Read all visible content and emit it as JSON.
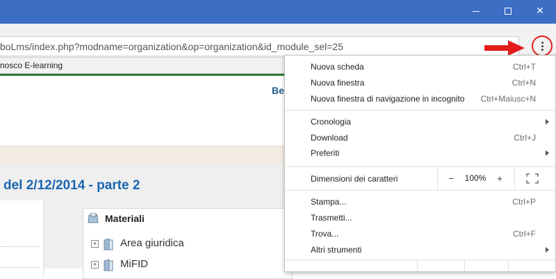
{
  "window": {
    "minimize_glyph": "—",
    "close_glyph": "✕"
  },
  "address_bar": {
    "url": "boLms/index.php?modname=organization&op=organization&id_module_sel=25"
  },
  "bookmarks": {
    "item": "nosco E-learning"
  },
  "page": {
    "header_partial": "Be",
    "lesson_title": "del 2/12/2014 - parte 2",
    "materiali": {
      "title": "Materiali",
      "items": [
        {
          "expander": "+",
          "label": "Area giuridica"
        },
        {
          "expander": "+",
          "label": "MiFID"
        }
      ]
    }
  },
  "menu": {
    "group1": [
      {
        "label": "Nuova scheda",
        "shortcut": "Ctrl+T"
      },
      {
        "label": "Nuova finestra",
        "shortcut": "Ctrl+N"
      },
      {
        "label": "Nuova finestra di navigazione in incognito",
        "shortcut": "Ctrl+Maiusc+N"
      }
    ],
    "group2": [
      {
        "label": "Cronologia"
      },
      {
        "label": "Download",
        "shortcut": "Ctrl+J"
      },
      {
        "label": "Preferiti"
      }
    ],
    "zoom": {
      "label": "Dimensioni dei caratteri",
      "minus": "−",
      "value": "100%",
      "plus": "+"
    },
    "group3": [
      {
        "label": "Stampa...",
        "shortcut": "Ctrl+P"
      },
      {
        "label": "Trasmetti..."
      },
      {
        "label": "Trova...",
        "shortcut": "Ctrl+F"
      },
      {
        "label": "Altri strumenti"
      }
    ]
  },
  "colors": {
    "titlebar": "#3c6fc3",
    "annotation_red": "#e21b1b",
    "title_blue": "#1a66b0"
  },
  "icons": [
    "menu-icon",
    "red-arrow-icon",
    "fullscreen-icon",
    "folder-icon",
    "materials-icon",
    "submenu-arrow-icon"
  ]
}
